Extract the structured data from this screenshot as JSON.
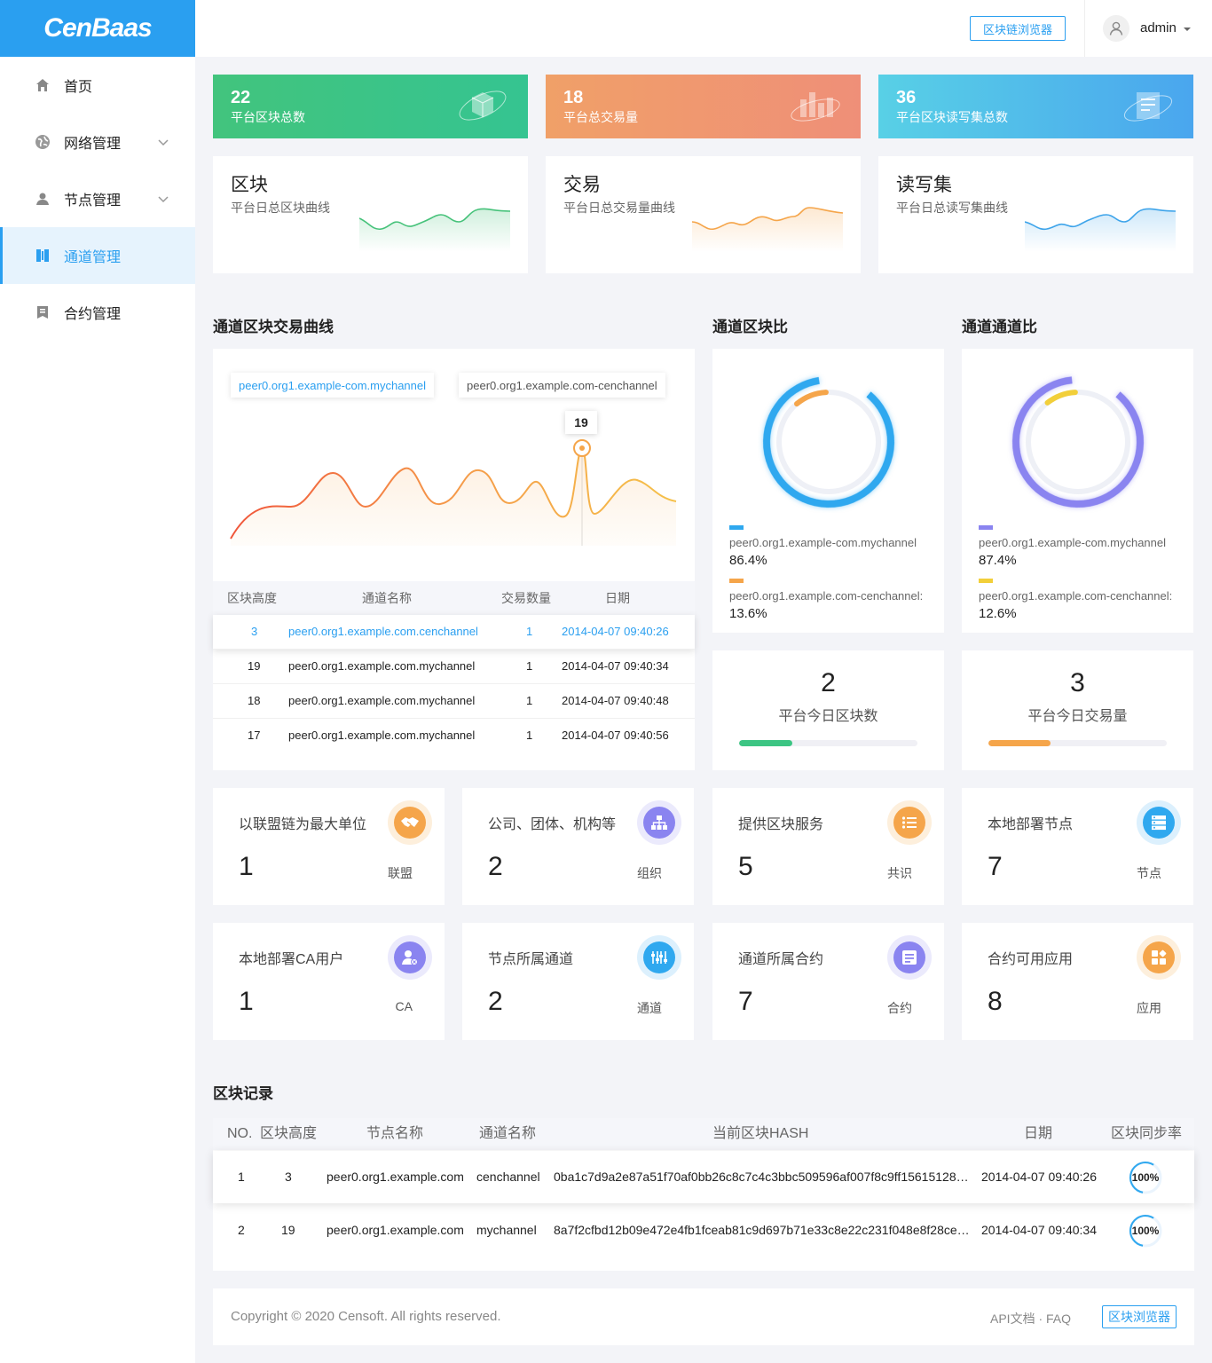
{
  "app": {
    "logo": "CenBaas"
  },
  "sidebar": {
    "items": [
      {
        "label": "首页",
        "icon": "home-icon",
        "expandable": false,
        "active": false
      },
      {
        "label": "网络管理",
        "icon": "globe-icon",
        "expandable": true,
        "active": false
      },
      {
        "label": "节点管理",
        "icon": "node-icon",
        "expandable": true,
        "active": false
      },
      {
        "label": "通道管理",
        "icon": "channel-icon",
        "expandable": false,
        "active": true
      },
      {
        "label": "合约管理",
        "icon": "contract-icon",
        "expandable": false,
        "active": false
      }
    ]
  },
  "header": {
    "explorer_button": "区块链浏览器",
    "username": "admin"
  },
  "banners": [
    {
      "value": "22",
      "label": "平台区块总数",
      "color": "#3cc583"
    },
    {
      "value": "18",
      "label": "平台总交易量",
      "color": "#f09a6c"
    },
    {
      "value": "36",
      "label": "平台区块读写集总数",
      "color": "#4cb9ea"
    }
  ],
  "curves": [
    {
      "title": "区块",
      "subtitle": "平台日总区块曲线",
      "color": "#46c27a"
    },
    {
      "title": "交易",
      "subtitle": "平台日总交易量曲线",
      "color": "#f5a54a"
    },
    {
      "title": "读写集",
      "subtitle": "平台日总读写集曲线",
      "color": "#3ea4ea"
    }
  ],
  "channel_curve": {
    "title": "通道区块交易曲线",
    "legend": [
      "peer0.org1.example-com.mychannel",
      "peer0.org1.example.com-cenchannel"
    ],
    "tooltip_value": "19",
    "table_headers": [
      "区块高度",
      "通道名称",
      "交易数量",
      "日期"
    ],
    "rows": [
      {
        "height": "3",
        "channel": "peer0.org1.example.com.cenchannel",
        "tx": "1",
        "date": "2014-04-07 09:40:26"
      },
      {
        "height": "19",
        "channel": "peer0.org1.example.com.mychannel",
        "tx": "1",
        "date": "2014-04-07 09:40:34"
      },
      {
        "height": "18",
        "channel": "peer0.org1.example.com.mychannel",
        "tx": "1",
        "date": "2014-04-07 09:40:48"
      },
      {
        "height": "17",
        "channel": "peer0.org1.example.com.mychannel",
        "tx": "1",
        "date": "2014-04-07 09:40:56"
      }
    ]
  },
  "block_ratio": {
    "title": "通道区块比",
    "items": [
      {
        "name": "peer0.org1.example-com.mychannel",
        "pct": "86.4%",
        "value": 86.4,
        "color": "#2fa8ef"
      },
      {
        "name": "peer0.org1.example.com-cenchannel:",
        "pct": "13.6%",
        "value": 13.6,
        "color": "#f5a54a"
      }
    ]
  },
  "channel_ratio": {
    "title": "通道通道比",
    "items": [
      {
        "name": "peer0.org1.example-com.mychannel",
        "pct": "87.4%",
        "value": 87.4,
        "color": "#8a84f0"
      },
      {
        "name": "peer0.org1.example.com-cenchannel:",
        "pct": "12.6%",
        "value": 12.6,
        "color": "#f2cf3a"
      }
    ]
  },
  "today": [
    {
      "value": "2",
      "label": "平台今日区块数",
      "progress": 0.3,
      "color": "#3cc583"
    },
    {
      "value": "3",
      "label": "平台今日交易量",
      "progress": 0.35,
      "color": "#f5a54a"
    }
  ],
  "info_cards": [
    {
      "title": "以联盟链为最大单位",
      "value": "1",
      "unit": "联盟",
      "icon": "handshake-icon",
      "color": "#f5a54a"
    },
    {
      "title": "公司、团体、机构等",
      "value": "2",
      "unit": "组织",
      "icon": "org-icon",
      "color": "#8a84f0"
    },
    {
      "title": "提供区块服务",
      "value": "5",
      "unit": "共识",
      "icon": "list-icon",
      "color": "#f5a54a"
    },
    {
      "title": "本地部署节点",
      "value": "7",
      "unit": "节点",
      "icon": "server-icon",
      "color": "#2fa8ef"
    },
    {
      "title": "本地部署CA用户",
      "value": "1",
      "unit": "CA",
      "icon": "user-cert-icon",
      "color": "#8a84f0"
    },
    {
      "title": "节点所属通道",
      "value": "2",
      "unit": "通道",
      "icon": "channel-icon",
      "color": "#2fa8ef"
    },
    {
      "title": "通道所属合约",
      "value": "7",
      "unit": "合约",
      "icon": "contract-icon",
      "color": "#8a84f0"
    },
    {
      "title": "合约可用应用",
      "value": "8",
      "unit": "应用",
      "icon": "apps-icon",
      "color": "#f5a54a"
    }
  ],
  "block_records": {
    "title": "区块记录",
    "headers": [
      "NO.",
      "区块高度",
      "节点名称",
      "通道名称",
      "当前区块HASH",
      "日期",
      "区块同步率"
    ],
    "rows": [
      {
        "no": "1",
        "height": "3",
        "node": "peer0.org1.example.com",
        "channel": "cenchannel",
        "hash": "0ba1c7d9a2e87a51f70af0bb26c8c7c4c3bbc509596af007f8c9ff15615128…",
        "date": "2014-04-07 09:40:26",
        "sync": "100%",
        "sync_value": 1.0
      },
      {
        "no": "2",
        "height": "19",
        "node": "peer0.org1.example.com",
        "channel": "mychannel",
        "hash": "8a7f2cfbd12b09e472e4fb1fceab81c9d697b71e33c8e22c231f048e8f28ce…",
        "date": "2014-04-07 09:40:34",
        "sync": "100%",
        "sync_value": 1.0
      }
    ]
  },
  "footer": {
    "copyright": "Copyright © 2020 Censoft. All rights reserved.",
    "links": "API文档 · FAQ",
    "explorer_button": "区块浏览器"
  }
}
